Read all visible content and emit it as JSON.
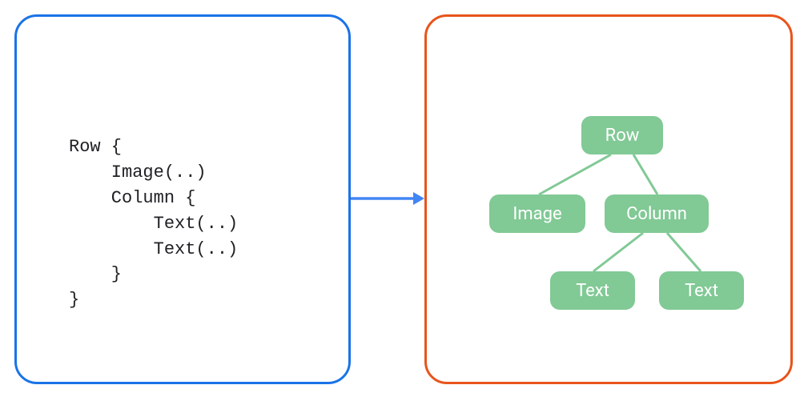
{
  "colors": {
    "left_border": "#1a73e8",
    "right_border": "#e8541b",
    "arrow": "#4285f4",
    "node_bg": "#81c995",
    "node_text": "#ffffff",
    "edge": "#81c995"
  },
  "code": {
    "lines": [
      "Row {",
      "    Image(..)",
      "    Column {",
      "        Text(..)",
      "        Text(..)",
      "    }",
      "}"
    ],
    "text": "Row {\n    Image(..)\n    Column {\n        Text(..)\n        Text(..)\n    }\n}"
  },
  "tree": {
    "root": "Row",
    "children": [
      {
        "label": "Image"
      },
      {
        "label": "Column",
        "children": [
          {
            "label": "Text"
          },
          {
            "label": "Text"
          }
        ]
      }
    ]
  },
  "nodes": {
    "row": "Row",
    "image": "Image",
    "column": "Column",
    "text1": "Text",
    "text2": "Text"
  }
}
